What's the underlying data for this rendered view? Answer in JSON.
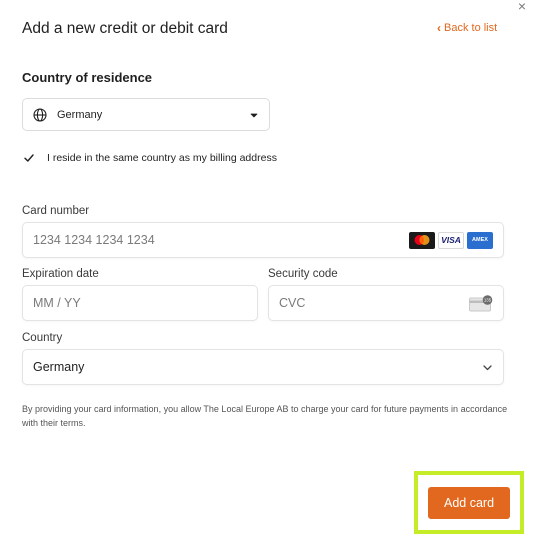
{
  "dialog": {
    "title": "Add a new credit or debit card",
    "close_label": "×",
    "back_link": "Back to list",
    "back_chevron": "‹"
  },
  "residence": {
    "heading": "Country of residence",
    "selected": "Germany",
    "same_as_billing_checked": true,
    "same_as_billing_label": "I reside in the same country as my billing address"
  },
  "card_form": {
    "card_number_label": "Card number",
    "card_number_placeholder": "1234 1234 1234 1234",
    "card_brands": [
      "mastercard-icon",
      "visa-icon",
      "amex-icon"
    ],
    "visa_text": "VISA",
    "amex_text": "AMEX",
    "expiration_label": "Expiration date",
    "expiration_placeholder": "MM / YY",
    "security_label": "Security code",
    "security_placeholder": "CVC",
    "cvc_badge": "135",
    "country_label": "Country",
    "country_value": "Germany"
  },
  "terms_text": "By providing your card information, you allow The Local Europe AB to charge your card for future payments in accordance with their terms.",
  "actions": {
    "add_card_label": "Add card"
  },
  "colors": {
    "accent": "#e2681f",
    "highlight": "#c4ec27",
    "amex_blue": "#2a6fd0",
    "visa_navy": "#1a1f71"
  }
}
